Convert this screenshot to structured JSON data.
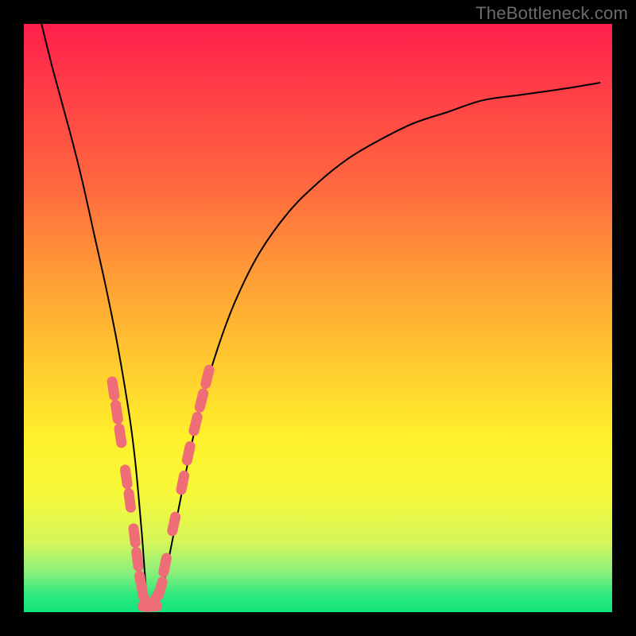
{
  "watermark": "TheBottleneck.com",
  "colors": {
    "frame": "#000000",
    "gradient_top": "#ff1f4c",
    "gradient_mid1": "#ff9a36",
    "gradient_mid2": "#fff02b",
    "gradient_bottom": "#11e57a",
    "curve": "#000000",
    "dots": "#ee6d77"
  },
  "chart_data": {
    "type": "line",
    "title": "",
    "xlabel": "",
    "ylabel": "",
    "xlim": [
      0,
      100
    ],
    "ylim": [
      0,
      100
    ],
    "grid": false,
    "legend": false,
    "series": [
      {
        "name": "curve",
        "x": [
          3,
          5,
          8,
          10,
          12,
          14,
          16,
          18,
          19,
          20,
          21,
          22,
          23,
          24,
          26,
          28,
          30,
          33,
          36,
          40,
          45,
          50,
          55,
          60,
          66,
          72,
          78,
          85,
          92,
          98
        ],
        "y": [
          100,
          92,
          81,
          73,
          64,
          55,
          45,
          33,
          25,
          14,
          2,
          1,
          2,
          6,
          16,
          26,
          35,
          45,
          53,
          61,
          68,
          73,
          77,
          80,
          83,
          85,
          87,
          88,
          89,
          90
        ]
      }
    ],
    "points": [
      {
        "name": "p1",
        "x": 15.2,
        "y": 38
      },
      {
        "name": "p2",
        "x": 15.8,
        "y": 34
      },
      {
        "name": "p3",
        "x": 16.4,
        "y": 30
      },
      {
        "name": "p4",
        "x": 17.4,
        "y": 23
      },
      {
        "name": "p5",
        "x": 18.0,
        "y": 19
      },
      {
        "name": "p6",
        "x": 18.8,
        "y": 13
      },
      {
        "name": "p7",
        "x": 19.3,
        "y": 9
      },
      {
        "name": "p8",
        "x": 19.9,
        "y": 5
      },
      {
        "name": "p9",
        "x": 20.6,
        "y": 2
      },
      {
        "name": "p10",
        "x": 21.4,
        "y": 1
      },
      {
        "name": "p11",
        "x": 22.2,
        "y": 2
      },
      {
        "name": "p12",
        "x": 23.2,
        "y": 4
      },
      {
        "name": "p13",
        "x": 24.0,
        "y": 8
      },
      {
        "name": "p14",
        "x": 25.5,
        "y": 15
      },
      {
        "name": "p15",
        "x": 27.0,
        "y": 22
      },
      {
        "name": "p16",
        "x": 28.0,
        "y": 27
      },
      {
        "name": "p17",
        "x": 29.2,
        "y": 32
      },
      {
        "name": "p18",
        "x": 30.2,
        "y": 36
      },
      {
        "name": "p19",
        "x": 31.2,
        "y": 40
      }
    ]
  }
}
